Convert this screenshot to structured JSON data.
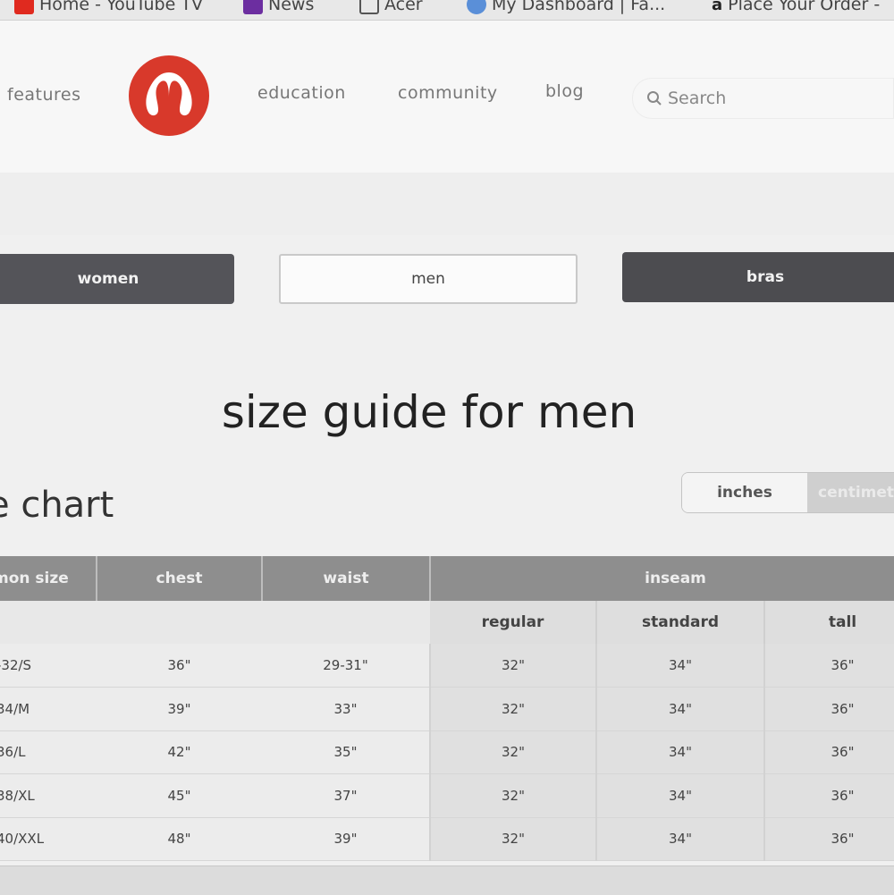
{
  "bookmarks": [
    {
      "label": "Home - YouTube TV"
    },
    {
      "label": "News"
    },
    {
      "label": "Acer"
    },
    {
      "label": "My Dashboard | Fa..."
    },
    {
      "label": "Place Your Order -"
    }
  ],
  "nav": {
    "features": "features",
    "education": "education",
    "community": "community",
    "blog": "blog",
    "search_placeholder": "Search"
  },
  "tabs": {
    "women": "women",
    "men": "men",
    "bras": "bras"
  },
  "page_title": "size guide for men",
  "section_title": "e chart",
  "units": {
    "inches": "inches",
    "centimeters": "centimet"
  },
  "table": {
    "headers": {
      "common_size": "mon size",
      "chest": "chest",
      "waist": "waist",
      "inseam": "inseam"
    },
    "inseam_sub": {
      "regular": "regular",
      "standard": "standard",
      "tall": "tall"
    },
    "rows": [
      {
        "size": "-32/S",
        "chest": "36\"",
        "waist": "29-31\"",
        "regular": "32\"",
        "standard": "34\"",
        "tall": "36\""
      },
      {
        "size": "34/M",
        "chest": "39\"",
        "waist": "33\"",
        "regular": "32\"",
        "standard": "34\"",
        "tall": "36\""
      },
      {
        "size": "36/L",
        "chest": "42\"",
        "waist": "35\"",
        "regular": "32\"",
        "standard": "34\"",
        "tall": "36\""
      },
      {
        "size": "38/XL",
        "chest": "45\"",
        "waist": "37\"",
        "regular": "32\"",
        "standard": "34\"",
        "tall": "36\""
      },
      {
        "size": "40/XXL",
        "chest": "48\"",
        "waist": "39\"",
        "regular": "32\"",
        "standard": "34\"",
        "tall": "36\""
      }
    ]
  },
  "colors": {
    "logo_red": "#d8392b",
    "tab_dark": "#545459",
    "header_gray": "#8e8e8e"
  }
}
